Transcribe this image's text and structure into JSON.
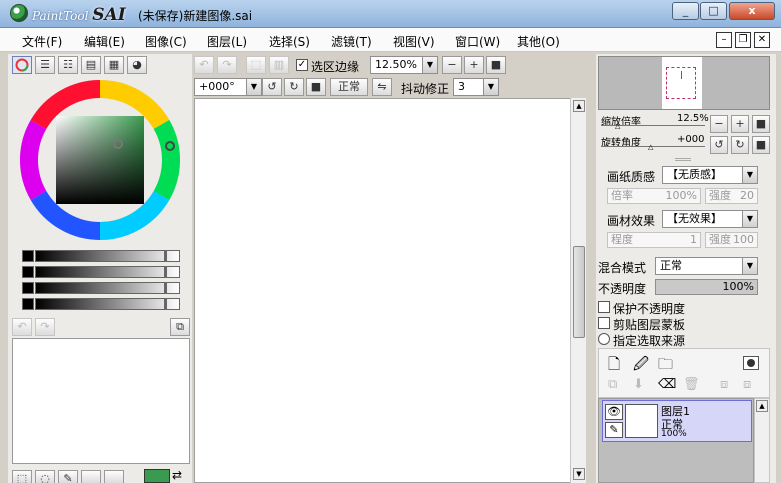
{
  "title_bar": {
    "brand_small": "PaintTool",
    "brand_big": "SAI",
    "document_title": "(未保存)新建图像.sai",
    "minimize": "_",
    "maximize": "□",
    "close": "x"
  },
  "menu": {
    "items": [
      "文件(F)",
      "编辑(E)",
      "图像(C)",
      "图层(L)",
      "选择(S)",
      "滤镜(T)",
      "视图(V)",
      "窗口(W)",
      "其他(O)"
    ]
  },
  "canvas_toolbar": {
    "selection_edge_label": "选区边缘",
    "selection_edge_checked": true,
    "zoom_value": "12.50%",
    "rotation_value": "+000°",
    "blend_button": "正常",
    "stabilizer_label": "抖动修正",
    "stabilizer_value": "3"
  },
  "navigator": {
    "zoom_label": "缩放倍率",
    "zoom_value": "12.5%",
    "rotate_label": "旋转角度",
    "rotate_value": "+000"
  },
  "layer_props": {
    "paper_texture_label": "画纸质感",
    "paper_texture_value": "【无质感】",
    "rate_label": "倍率",
    "rate_value": "100%",
    "strength_label": "强度",
    "strength_value": "20",
    "material_effect_label": "画材效果",
    "material_effect_value": "【无效果】",
    "degree_label": "程度",
    "degree_value": "1",
    "strength2_label": "强度",
    "strength2_value": "100",
    "blend_mode_label": "混合模式",
    "blend_mode_value": "正常",
    "opacity_label": "不透明度",
    "opacity_value": "100%",
    "protect_opacity": "保护不透明度",
    "clipping_mask": "剪贴图层蒙板",
    "selection_source": "指定选取来源"
  },
  "layers": [
    {
      "name": "图层1",
      "mode": "正常",
      "opacity": "100%"
    }
  ],
  "colors": {
    "primary": "#3a9a50",
    "secondary": "#ffffff",
    "panel_bg": "#ecebe8"
  }
}
